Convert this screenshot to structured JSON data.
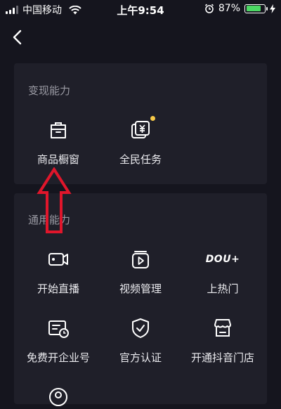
{
  "status_bar": {
    "carrier": "中国移动",
    "time": "上午9:54",
    "battery_percent": "87%",
    "battery_level": 0.87
  },
  "sections": [
    {
      "title": "变现能力",
      "items": [
        {
          "label": "商品橱窗",
          "icon": "shop-window-icon"
        },
        {
          "label": "全民任务",
          "icon": "task-yen-icon"
        }
      ]
    },
    {
      "title": "通用能力",
      "items": [
        {
          "label": "开始直播",
          "icon": "live-camera-icon"
        },
        {
          "label": "视频管理",
          "icon": "video-manage-icon"
        },
        {
          "label": "上热门",
          "icon": "dou-plus-icon"
        },
        {
          "label": "免费开企业号",
          "icon": "enterprise-account-icon"
        },
        {
          "label": "官方认证",
          "icon": "shield-check-icon"
        },
        {
          "label": "开通抖音门店",
          "icon": "store-icon"
        }
      ]
    }
  ],
  "dou_plus_logo_text": "DOU+",
  "colors": {
    "background": "#15151e",
    "card": "#1f1f29",
    "arrow": "#e0162b",
    "badge": "#f7c948",
    "battery": "#4cd964"
  }
}
